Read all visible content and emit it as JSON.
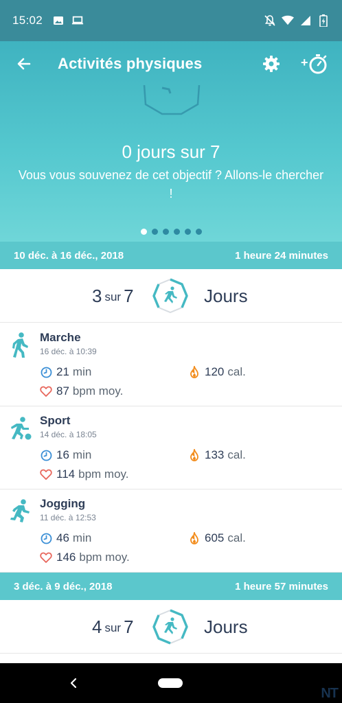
{
  "status_bar": {
    "time": "15:02",
    "left_icons": [
      "image-icon",
      "laptop-icon"
    ],
    "right_icons": [
      "notifications-off-icon",
      "wifi-icon",
      "signal-icon",
      "battery-icon"
    ]
  },
  "header": {
    "title": "Activités physiques",
    "back_icon": "arrow-left-icon",
    "settings_icon": "gear-icon",
    "add_exercise_icon": "add-stopwatch-icon",
    "add_exercise_prefix": "+"
  },
  "goal_card": {
    "main": "0 jours sur 7",
    "sub": "Vous vous souvenez de cet objectif ? Allons-le chercher !",
    "pager_total": 6,
    "pager_active": 0
  },
  "weeks": [
    {
      "range": "10 déc. à 16 déc., 2018",
      "duration": "1 heure 24 minutes",
      "count": "3",
      "sur": "sur",
      "total": "7",
      "label": "Jours",
      "progress": 0.43,
      "activities": [
        {
          "name": "Marche",
          "date": "16 déc. à 10:39",
          "duration_value": "21",
          "duration_unit": "min",
          "calories_value": "120",
          "calories_unit": "cal.",
          "bpm_value": "87",
          "bpm_unit": "bpm moy.",
          "icon": "walk-icon"
        },
        {
          "name": "Sport",
          "date": "14 déc. à 18:05",
          "duration_value": "16",
          "duration_unit": "min",
          "calories_value": "133",
          "calories_unit": "cal.",
          "bpm_value": "114",
          "bpm_unit": "bpm moy.",
          "icon": "sport-icon"
        },
        {
          "name": "Jogging",
          "date": "11 déc. à 12:53",
          "duration_value": "46",
          "duration_unit": "min",
          "calories_value": "605",
          "calories_unit": "cal.",
          "bpm_value": "146",
          "bpm_unit": "bpm moy.",
          "icon": "run-icon"
        }
      ]
    },
    {
      "range": "3 déc. à 9 déc., 2018",
      "duration": "1 heure 57 minutes",
      "count": "4",
      "sur": "sur",
      "total": "7",
      "label": "Jours",
      "progress": 0.57
    }
  ],
  "watermark": "NT",
  "colors": {
    "accent": "#3fb3c0",
    "status_bar": "#3a8b9a",
    "week_header": "#5bc7cc",
    "text_dark": "#2e3d57",
    "flame": "#f28c1c",
    "heart": "#e8665b",
    "clock": "#3b8fd6"
  }
}
